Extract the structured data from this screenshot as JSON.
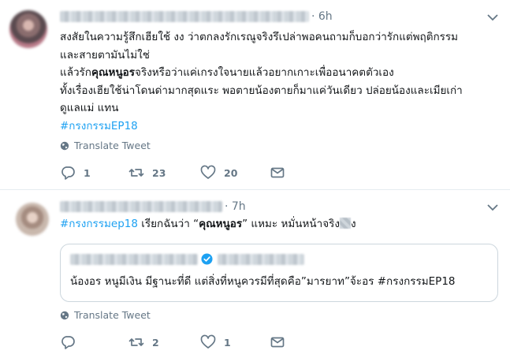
{
  "tweets": [
    {
      "time": "· 6h",
      "lines": [
        "สงสัยในความรู้สึกเฮียใช้ งง ว่าตกลงรักเรณูจริงรึเปล่าพอคนถามก็บอกว่ารักแต่พฤติกรรม",
        "และสายตามันไม่ใช่",
        [
          "แล้วรัก",
          "คุณหนูอร",
          "จริงหรือว่าแค่เกรงใจนายแล้วอยากเกาะเพื่ออนาคตตัวเอง"
        ],
        "ทั้งเรื่องเฮียใช้น่าโดนด่ามากสุดแระ พอตายน้องตายก็มาแค่วันเดียว ปล่อยน้องและเมียเก่า",
        "ดูแลแม่ แทน"
      ],
      "hashtag": "#กรงกรรมEP18",
      "translate_label": "Translate Tweet",
      "reply_count": "1",
      "retweet_count": "23",
      "like_count": "20"
    },
    {
      "time": "· 7h",
      "hashtag": "#กรงกรรมep18",
      "text_before": " เรียกฉันว่า “",
      "bold_text": "คุณหนูอร",
      "text_after": "” แหมะ หมั่นหน้าจริง",
      "text_end": "ง",
      "quote_text": "น้องอร หนูมีเงิน มีฐานะที่ดี แต่สิ่งที่หนูควรมีที่สุดคือ”มารยาท”จ้ะอร #กรงกรรมEP18",
      "translate_label": "Translate Tweet",
      "reply_count": "",
      "retweet_count": "2",
      "like_count": "1"
    }
  ],
  "colors": {
    "link": "#1da1f2",
    "muted": "#657786",
    "verified": "#1da1f2",
    "divider": "#e6ecf0"
  },
  "icons": [
    "chevron-down-icon",
    "globe-icon",
    "reply-icon",
    "retweet-icon",
    "heart-icon",
    "envelope-icon",
    "verified-badge-icon"
  ]
}
